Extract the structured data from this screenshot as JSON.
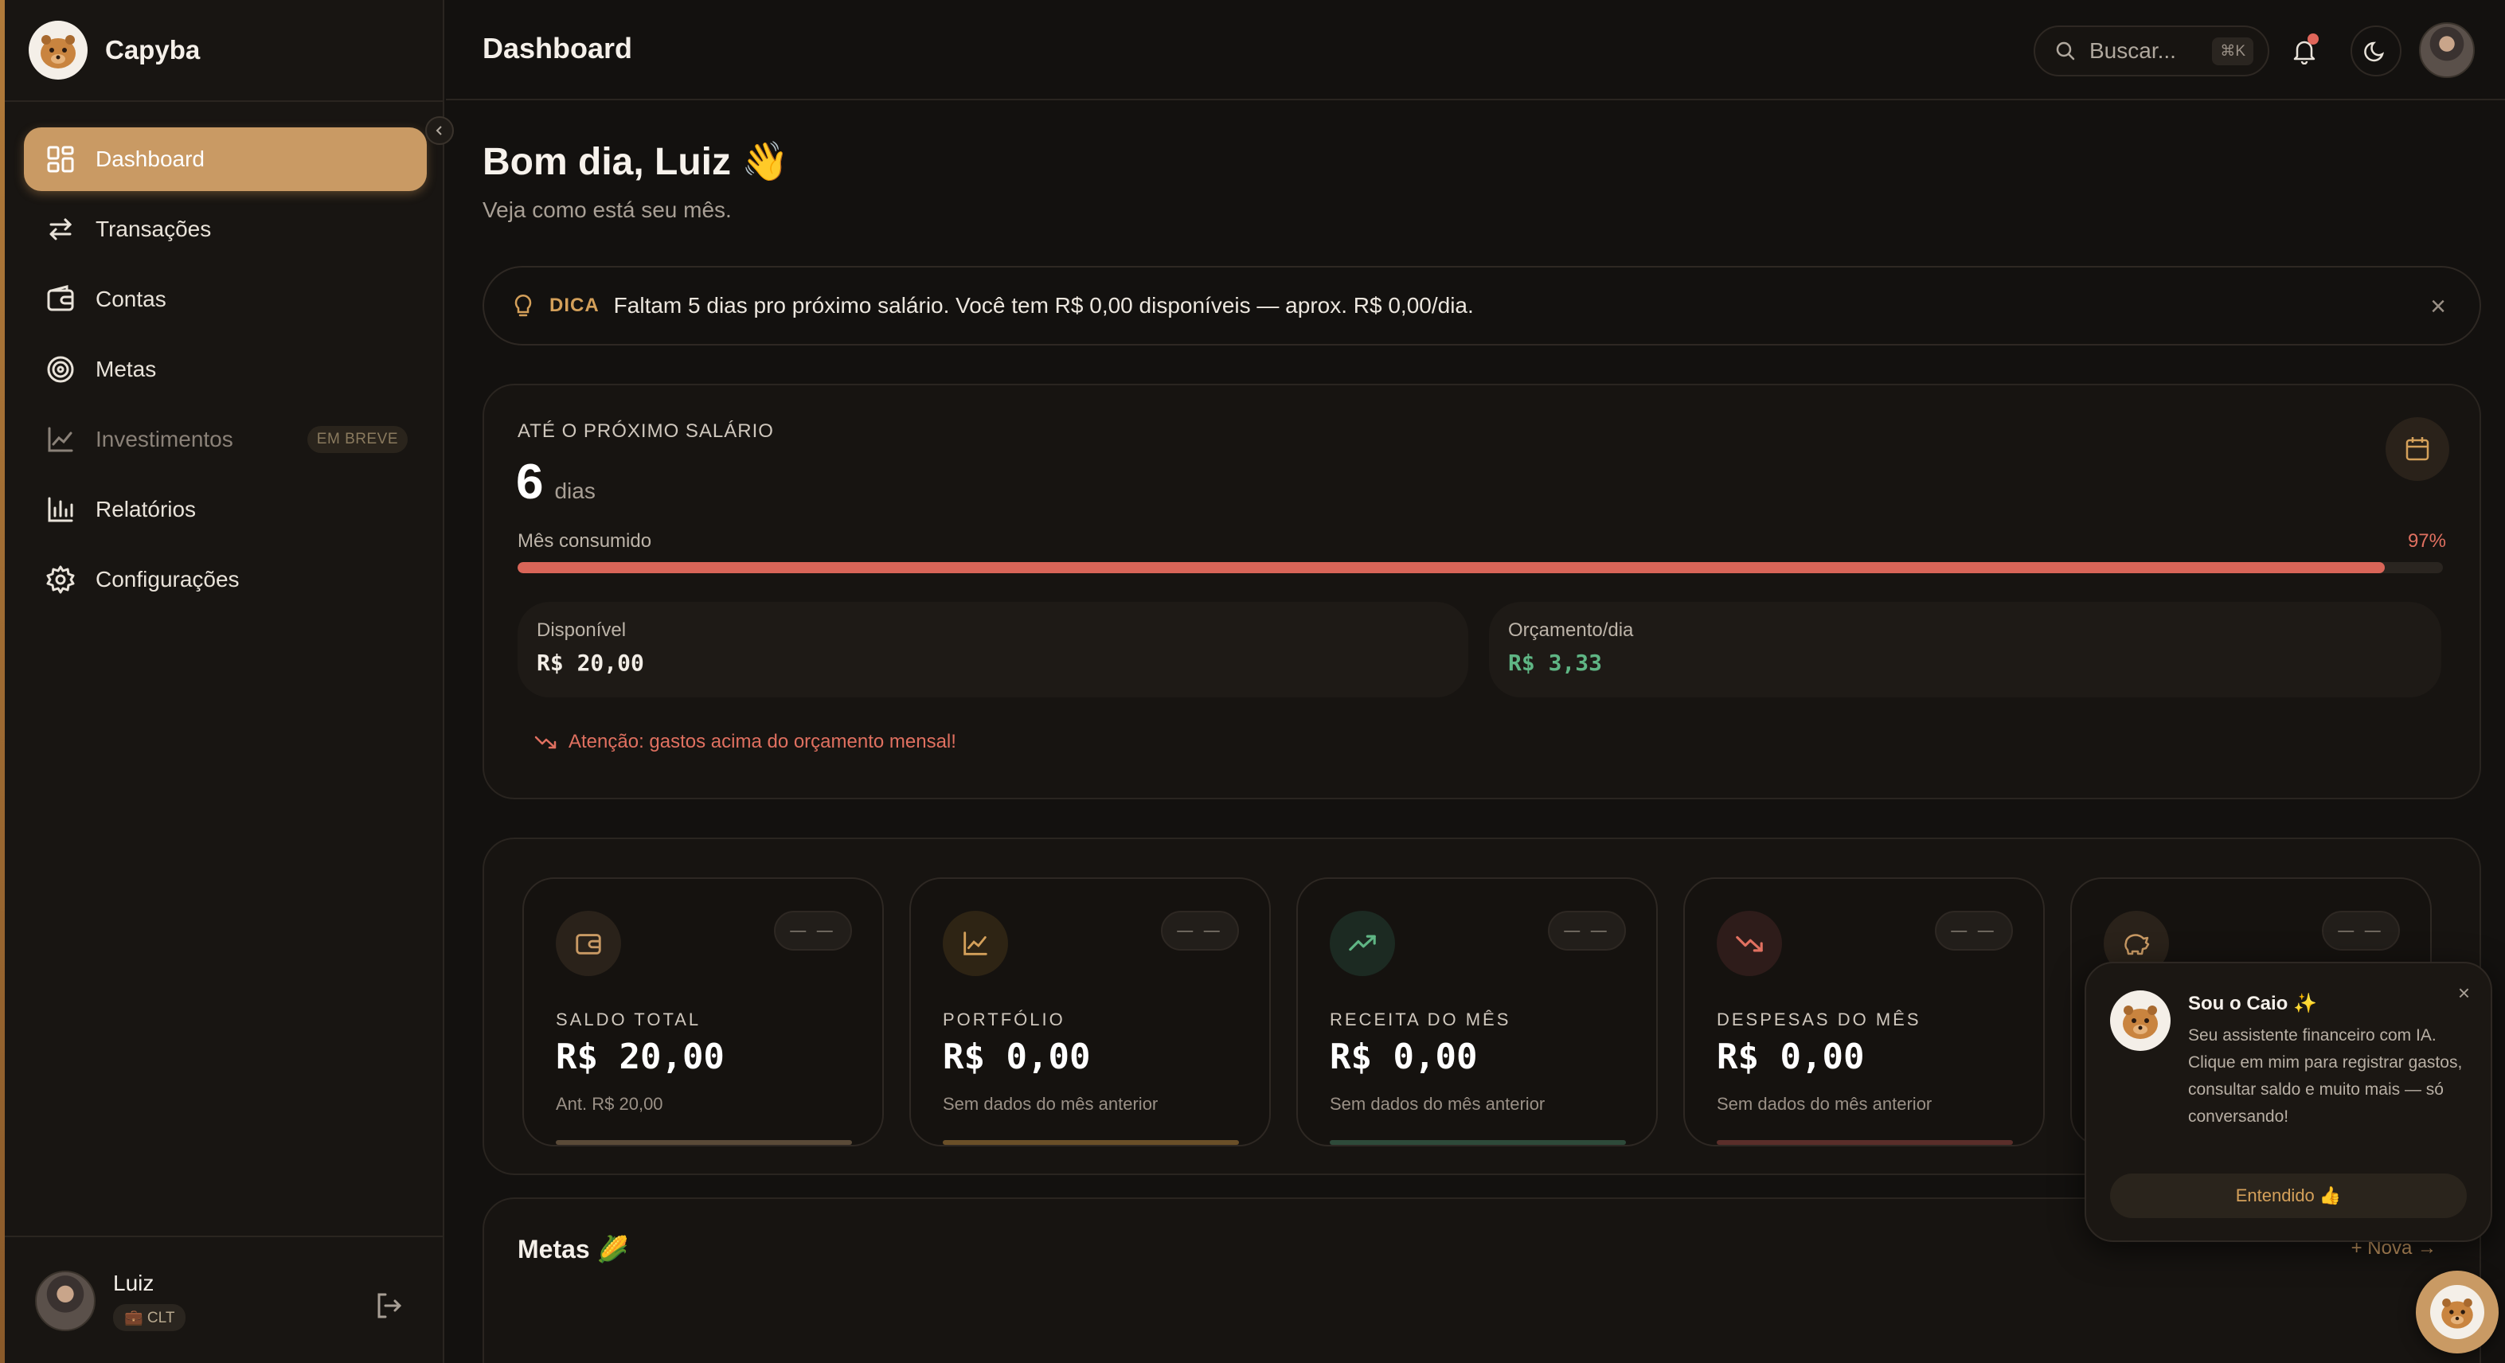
{
  "app": {
    "name": "Capyba"
  },
  "sidebar": {
    "items": [
      {
        "label": "Dashboard",
        "icon": "dashboard-icon",
        "active": true
      },
      {
        "label": "Transações",
        "icon": "arrows-icon"
      },
      {
        "label": "Contas",
        "icon": "wallet-icon"
      },
      {
        "label": "Metas",
        "icon": "target-icon"
      },
      {
        "label": "Investimentos",
        "icon": "chart-line-icon",
        "badge": "EM BREVE",
        "disabled": true
      },
      {
        "label": "Relatórios",
        "icon": "bar-chart-icon"
      },
      {
        "label": "Configurações",
        "icon": "gear-icon"
      }
    ],
    "user": {
      "name": "Luiz",
      "tag": "💼 CLT"
    }
  },
  "header": {
    "title": "Dashboard",
    "search_placeholder": "Buscar...",
    "shortcut": "⌘K"
  },
  "greeting": {
    "title": "Bom dia, Luiz 👋",
    "subtitle": "Veja como está seu mês."
  },
  "tip": {
    "tag": "DICA",
    "text": "Faltam 5 dias pro próximo salário. Você tem R$ 0,00 disponíveis — aprox. R$ 0,00/dia."
  },
  "salary": {
    "label": "ATÉ O PRÓXIMO SALÁRIO",
    "days": "6",
    "days_unit": "dias",
    "progress_label": "Mês consumido",
    "progress_text": "97%",
    "progress_value": 0.97,
    "available_label": "Disponível",
    "available_value": "R$ 20,00",
    "budget_label": "Orçamento/dia",
    "budget_value": "R$ 3,33",
    "warning": "Atenção: gastos acima do orçamento mensal!"
  },
  "stats": [
    {
      "title": "SALDO TOTAL",
      "value": "R$ 20,00",
      "note": "Ant. R$ 20,00",
      "pill": "— —",
      "icon": "wallet-icon",
      "color": "#c99a64"
    },
    {
      "title": "PORTFÓLIO",
      "value": "R$ 0,00",
      "note": "Sem dados do mês anterior",
      "pill": "— —",
      "icon": "chart-line-icon",
      "color": "#d4a05a"
    },
    {
      "title": "RECEITA DO MÊS",
      "value": "R$ 0,00",
      "note": "Sem dados do mês anterior",
      "pill": "— —",
      "icon": "trending-up-icon",
      "color": "#5fb584"
    },
    {
      "title": "DESPESAS DO MÊS",
      "value": "R$ 0,00",
      "note": "Sem dados do mês anterior",
      "pill": "— —",
      "icon": "trending-down-icon",
      "color": "#e07060"
    },
    {
      "title": "",
      "value": "",
      "note": "",
      "pill": "— —",
      "icon": "piggy-bank-icon",
      "color": "#c99a64"
    }
  ],
  "goals": {
    "title": "Metas 🌽",
    "new_label": "+ Nova →"
  },
  "assistant": {
    "title": "Sou o Caio ✨",
    "text": "Seu assistente financeiro com IA. Clique em mim para registrar gastos, consultar saldo e muito mais — só conversando!",
    "button": "Entendido 👍"
  }
}
